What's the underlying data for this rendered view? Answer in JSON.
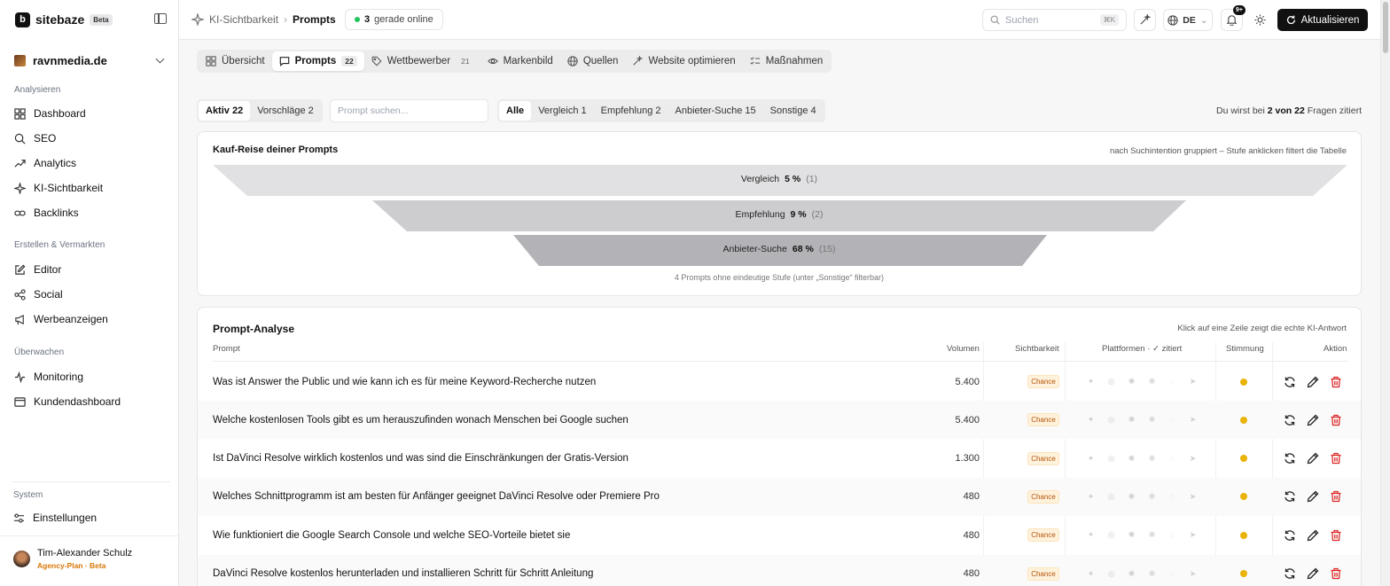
{
  "brand": {
    "name": "sitebaze",
    "badge": "Beta",
    "logo_letter": "b"
  },
  "workspace": {
    "name": "ravnmedia.de"
  },
  "sidebar": {
    "sections": [
      {
        "title": "Analysieren",
        "items": [
          {
            "label": "Dashboard",
            "icon": "grid-icon"
          },
          {
            "label": "SEO",
            "icon": "search-icon"
          },
          {
            "label": "Analytics",
            "icon": "trend-icon"
          },
          {
            "label": "KI-Sichtbarkeit",
            "icon": "sparkle-icon"
          },
          {
            "label": "Backlinks",
            "icon": "link-icon"
          }
        ]
      },
      {
        "title": "Erstellen & Vermarkten",
        "items": [
          {
            "label": "Editor",
            "icon": "edit-icon"
          },
          {
            "label": "Social",
            "icon": "share-icon"
          },
          {
            "label": "Werbeanzeigen",
            "icon": "megaphone-icon"
          }
        ]
      },
      {
        "title": "Überwachen",
        "items": [
          {
            "label": "Monitoring",
            "icon": "pulse-icon"
          },
          {
            "label": "Kundendashboard",
            "icon": "window-icon"
          }
        ]
      },
      {
        "title": "System",
        "items": [
          {
            "label": "Einstellungen",
            "icon": "sliders-icon"
          }
        ]
      }
    ],
    "user": {
      "name": "Tim-Alexander Schulz",
      "plan": "Agency-Plan · Beta"
    }
  },
  "topbar": {
    "breadcrumb_parent": "KI-Sichtbarkeit",
    "breadcrumb_current": "Prompts",
    "online_count": "3",
    "online_label": "gerade online",
    "search_placeholder": "Suchen",
    "search_shortcut": "⌘K",
    "language": "DE",
    "notifications": "9+",
    "refresh_label": "Aktualisieren"
  },
  "tabs": [
    {
      "label": "Übersicht",
      "count": "",
      "active": false
    },
    {
      "label": "Prompts",
      "count": "22",
      "active": true
    },
    {
      "label": "Wettbewerber",
      "count": "21",
      "active": false
    },
    {
      "label": "Markenbild",
      "count": "",
      "active": false
    },
    {
      "label": "Quellen",
      "count": "",
      "active": false
    },
    {
      "label": "Website optimieren",
      "count": "",
      "active": false
    },
    {
      "label": "Maßnahmen",
      "count": "",
      "active": false
    }
  ],
  "filters": {
    "status": [
      "Aktiv 22",
      "Vorschläge 2"
    ],
    "prompt_search_placeholder": "Prompt suchen...",
    "intents": [
      "Alle",
      "Vergleich 1",
      "Empfehlung 2",
      "Anbieter-Suche 15",
      "Sonstige 4"
    ],
    "cited_prefix": "Du wirst bei",
    "cited_value": "2 von 22",
    "cited_suffix": "Fragen zitiert"
  },
  "funnel": {
    "title": "Kauf-Reise deiner Prompts",
    "hint": "nach Suchintention gruppiert – Stufe anklicken filtert die Tabelle",
    "stages": [
      {
        "label": "Vergleich",
        "percent": "5 %",
        "count": "(1)",
        "color": "#e1e1e3"
      },
      {
        "label": "Empfehlung",
        "percent": "9 %",
        "count": "(2)",
        "color": "#cdcdd0"
      },
      {
        "label": "Anbieter-Suche",
        "percent": "68 %",
        "count": "(15)",
        "color": "#b3b3b7"
      }
    ],
    "note": "4 Prompts ohne eindeutige Stufe (unter „Sonstige“ filterbar)"
  },
  "analysis": {
    "title": "Prompt-Analyse",
    "hint": "Klick auf eine Zeile zeigt die echte KI-Antwort",
    "columns": {
      "prompt": "Prompt",
      "volume": "Volumen",
      "visibility": "Sichtbarkeit",
      "platforms": "Plattformen · ✓ zitiert",
      "sentiment": "Stimmung",
      "action": "Aktion"
    },
    "rows": [
      {
        "prompt": "Was ist Answer the Public und wie kann ich es für meine Keyword-Recherche nutzen",
        "volume": "5.400",
        "visibility": "Chance"
      },
      {
        "prompt": "Welche kostenlosen Tools gibt es um herauszufinden wonach Menschen bei Google suchen",
        "volume": "5.400",
        "visibility": "Chance"
      },
      {
        "prompt": "Ist DaVinci Resolve wirklich kostenlos und was sind die Einschränkungen der Gratis-Version",
        "volume": "1.300",
        "visibility": "Chance"
      },
      {
        "prompt": "Welches Schnittprogramm ist am besten für Anfänger geeignet DaVinci Resolve oder Premiere Pro",
        "volume": "480",
        "visibility": "Chance"
      },
      {
        "prompt": "Wie funktioniert die Google Search Console und welche SEO-Vorteile bietet sie",
        "volume": "480",
        "visibility": "Chance"
      },
      {
        "prompt": "DaVinci Resolve kostenlos herunterladen und installieren Schritt für Schritt Anleitung",
        "volume": "480",
        "visibility": "Chance"
      }
    ],
    "platform_icons": [
      "chatgpt-icon",
      "perplexity-icon",
      "gemini-icon",
      "claude-icon",
      "copilot-icon",
      "grok-icon"
    ],
    "sentiment_color": "#eab308"
  }
}
